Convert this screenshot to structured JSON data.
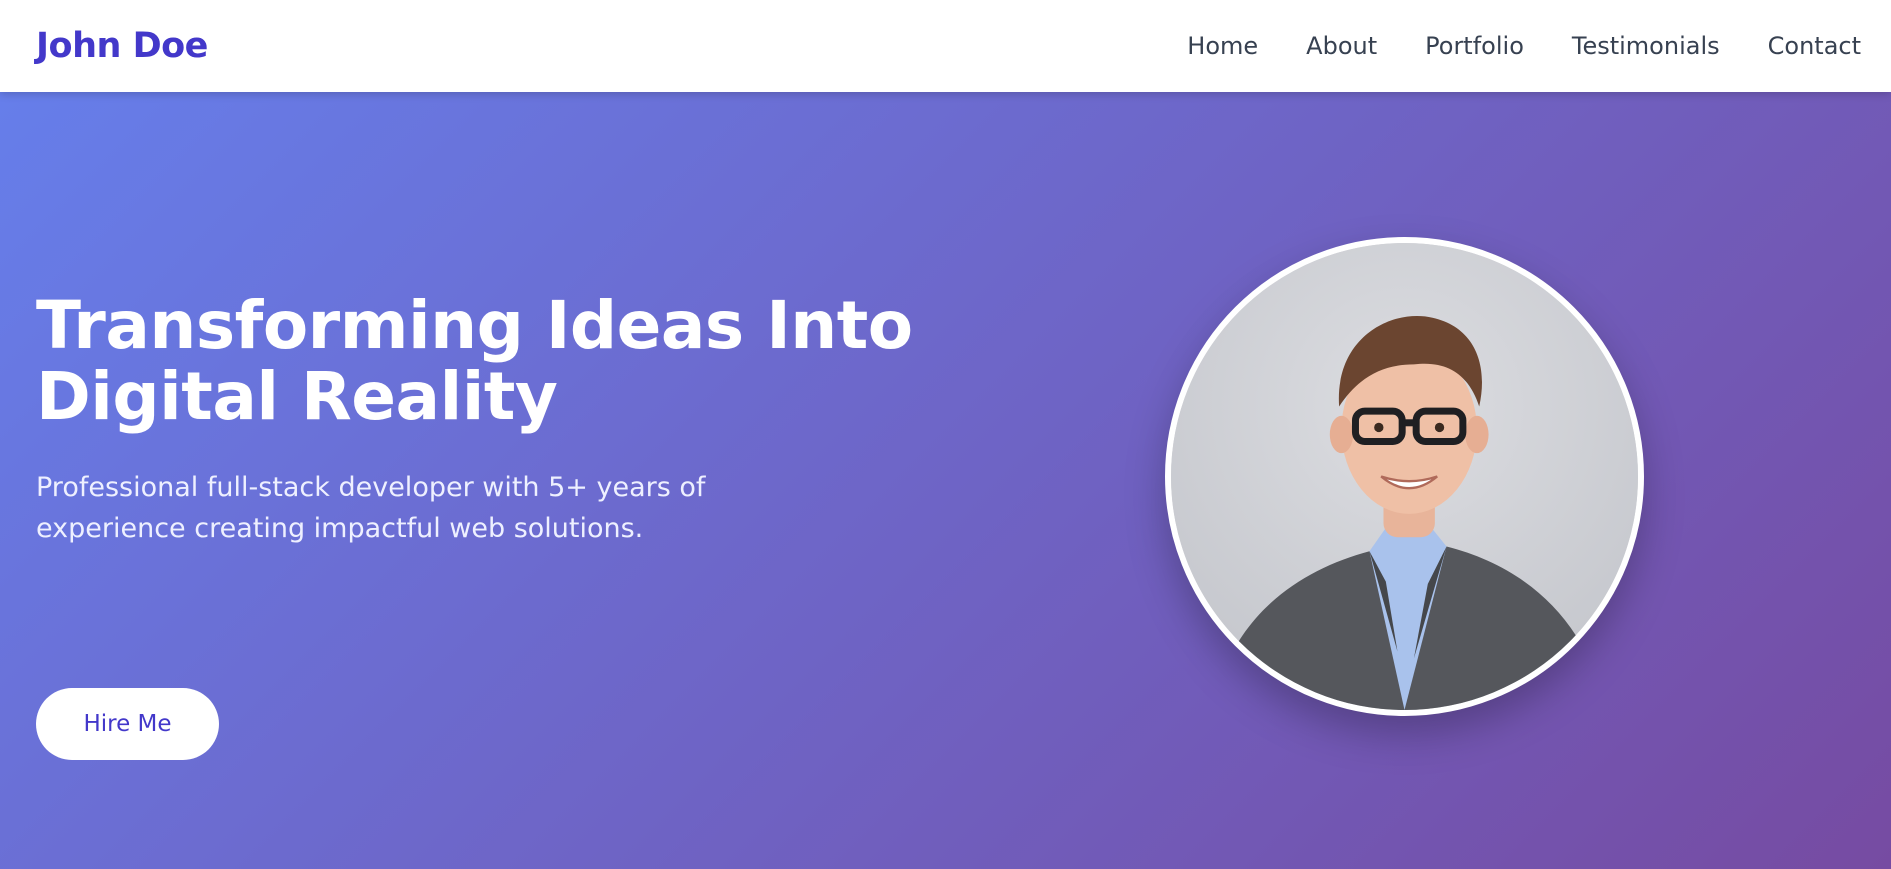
{
  "header": {
    "brand": "John Doe",
    "nav": [
      {
        "label": "Home"
      },
      {
        "label": "About"
      },
      {
        "label": "Portfolio"
      },
      {
        "label": "Testimonials"
      },
      {
        "label": "Contact"
      }
    ]
  },
  "hero": {
    "title_line1": "Transforming Ideas Into",
    "title_line2": "Digital Reality",
    "subtitle": "Professional full-stack developer with 5+ years of experience creating impactful web solutions.",
    "cta_label": "Hire Me"
  },
  "colors": {
    "brand": "#4338ca",
    "gradient_start": "#667eea",
    "gradient_end": "#764ba2",
    "nav_text": "#374151"
  }
}
